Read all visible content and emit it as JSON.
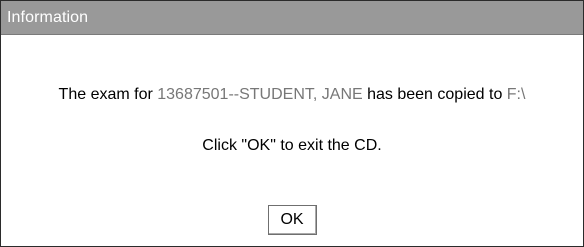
{
  "dialog": {
    "title": "Information",
    "message_prefix": "The exam for ",
    "student_id_name": "13687501--STUDENT, JANE",
    "message_middle": " has been copied to ",
    "drive": "F:\\",
    "instruction": "Click \"OK\" to exit the CD.",
    "ok_label": "OK"
  },
  "colors": {
    "title_bar": "#999999",
    "title_text": "#ffffff",
    "highlight_text": "#777777",
    "border": "#2b2b2b"
  }
}
